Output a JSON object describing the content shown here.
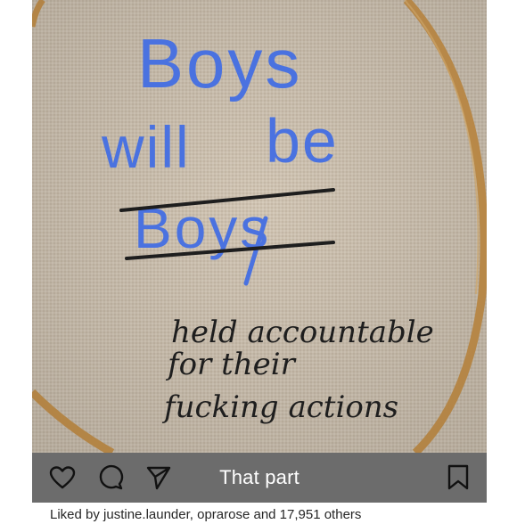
{
  "post": {
    "caption": "That part",
    "liked_by": "Liked by justine.launder, oprarose and 17,951 others"
  },
  "embroidery": {
    "line1": "Boys",
    "line2a": "will",
    "line2b": "be",
    "struck": "Boys",
    "script1": "held accountable",
    "script2": "for their",
    "script3": "fucking actions"
  },
  "icons": {
    "like": "heart-icon",
    "comment": "comment-icon",
    "share": "send-icon",
    "save": "bookmark-icon"
  },
  "colors": {
    "thread_blue": "#4a72e0",
    "thread_black": "#1e1e1e",
    "linen": "#cfc3b2",
    "hoop": "#c9954f",
    "bar": "#6c6c6c"
  }
}
